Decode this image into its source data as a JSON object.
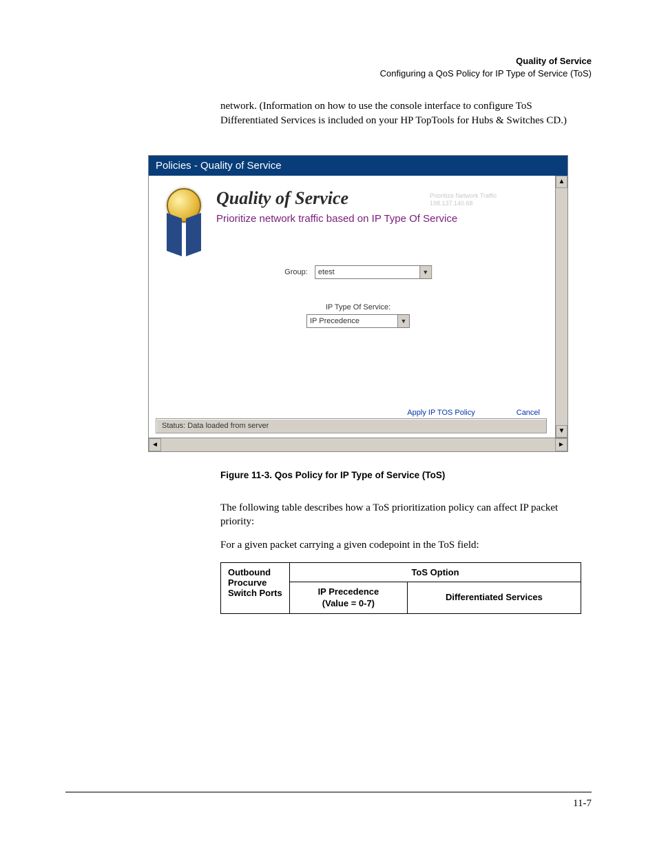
{
  "header": {
    "title": "Quality of Service",
    "subtitle": "Configuring a QoS Policy for IP Type of Service (ToS)"
  },
  "intro_paragraph": "network. (Information on how to use the console interface to configure ToS Differentiated Services is included on your HP TopTools for Hubs & Switches CD.)",
  "figure": {
    "window_title": "Policies - Quality of Service",
    "qos_title": "Quality of Service",
    "ghost_top": "Prioritize Network Traffic",
    "ghost_ip": "198.137.140.68",
    "qos_subtitle": "Prioritize network traffic based on IP Type Of Service",
    "group_label": "Group:",
    "group_value": "etest",
    "tos_label": "IP Type Of Service:",
    "tos_value": "IP Precedence",
    "apply_btn": "Apply IP TOS Policy",
    "cancel_btn": "Cancel",
    "status": "Status:  Data loaded from server"
  },
  "figure_caption": "Figure 11-3.  Qos Policy for IP Type of Service (ToS)",
  "after_text1": "The following table describes how a ToS prioritization policy can affect IP packet priority:",
  "after_text2": "For a given packet carrying a given codepoint in the ToS field:",
  "table": {
    "left_head": "Outbound Procurve Switch Ports",
    "span_head": "ToS Option",
    "sub1": "IP Precedence",
    "sub1b": "(Value = 0-7)",
    "sub2": "Differentiated Services"
  },
  "page_number": "11-7"
}
